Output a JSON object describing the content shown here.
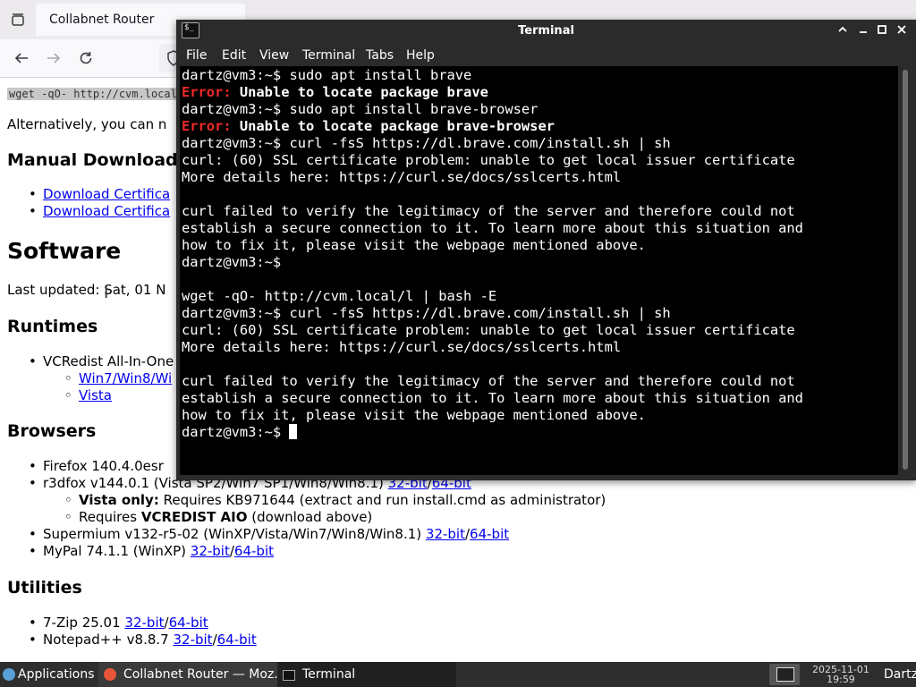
{
  "browser": {
    "tab_title": "Collabnet Router",
    "page": {
      "command_snippet": "wget -qO- http://cvm.local",
      "alt_text": "Alternatively, you can n",
      "manual_download_heading": "Manual Download",
      "cert_link_1": "Download Certifica",
      "cert_link_2": "Download Certifica",
      "software_heading": "Software",
      "last_updated": "Last updated: Sat, 01 N",
      "runtimes_heading": "Runtimes",
      "vcredist": "VCRedist All-In-One",
      "vcredist_link_1": "Win7/Win8/Wi",
      "vcredist_link_2": "Vista",
      "browsers_heading": "Browsers",
      "firefox": "Firefox 140.4.0esr",
      "r3dfox": "r3dfox v144.0.1 (Vista SP2/Win7 SP1/Win8/Win8.1)",
      "r3dfox_32": "32-bit",
      "r3dfox_64": "64-bit",
      "vista_only_bold": "Vista only:",
      "vista_only_text": "Requires KB971644 (extract and run install.cmd as administrator)",
      "requires_text": "Requires",
      "requires_bold": "VCREDIST AIO",
      "requires_tail": "(download above)",
      "supermium": "Supermium v132-r5-02 (WinXP/Vista/Win7/Win8/Win8.1)",
      "supermium_32": "32-bit",
      "supermium_64": "64-bit",
      "mypal": "MyPal 74.1.1 (WinXP)",
      "mypal_32": "32-bit",
      "mypal_64": "64-bit",
      "utilities_heading": "Utilities",
      "sevenzip": "7-Zip 25.01",
      "sevenzip_32": "32-bit",
      "sevenzip_64": "64-bit",
      "notepadpp": "Notepad++ v8.8.7",
      "notepadpp_32": "32-bit",
      "notepadpp_64": "64-bit",
      "slash": "/"
    }
  },
  "terminal": {
    "title": "Terminal",
    "menu": [
      "File",
      "Edit",
      "View",
      "Terminal",
      "Tabs",
      "Help"
    ],
    "prompt": "dartz@vm3:~$ ",
    "cmd1": "sudo apt install brave",
    "error_label": "Error:",
    "err1": " Unable to locate package brave",
    "cmd2": "sudo apt install brave-browser",
    "err2": " Unable to locate package brave-browser",
    "cmd3": "curl -fsS https://dl.brave.com/install.sh | sh",
    "ssl_line": "curl: (60) SSL certificate problem: unable to get local issuer certificate",
    "details_line": "More details here: https://curl.se/docs/sslcerts.html",
    "fail_1": "curl failed to verify the legitimacy of the server and therefore could not",
    "fail_2": "establish a secure connection to it. To learn more about this situation and",
    "fail_3": "how to fix it, please visit the webpage mentioned above.",
    "wget_line": "wget -qO- http://cvm.local/l | bash -E"
  },
  "taskbar": {
    "applications": "Applications",
    "firefox_task": "Collabnet Router — Moz...",
    "terminal_task": "Terminal",
    "date": "2025-11-01",
    "time": "19:59",
    "user": "Dartz"
  }
}
